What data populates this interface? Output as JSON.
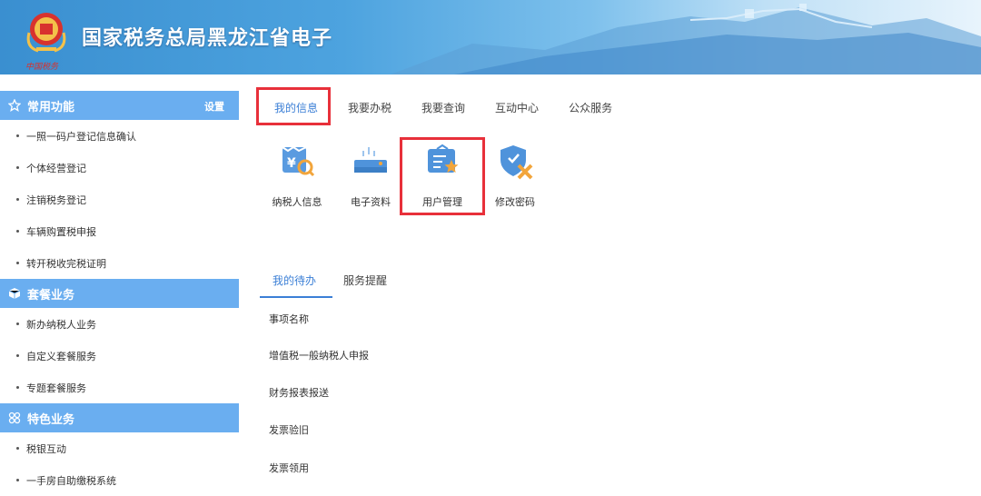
{
  "header": {
    "title": "国家税务总局黑龙江省电子",
    "emblem_caption": "中国税务"
  },
  "sidebar": {
    "sections": [
      {
        "title": "常用功能",
        "icon": "star-icon",
        "setting_label": "设置",
        "items": [
          "一照一码户登记信息确认",
          "个体经营登记",
          "注销税务登记",
          "车辆购置税申报",
          "转开税收完税证明"
        ]
      },
      {
        "title": "套餐业务",
        "icon": "cube-icon",
        "items": [
          "新办纳税人业务",
          "自定义套餐服务",
          "专题套餐服务"
        ]
      },
      {
        "title": "特色业务",
        "icon": "grid-icon",
        "items": [
          "税银互动",
          "一手房自助缴税系统"
        ]
      }
    ]
  },
  "tabs": [
    "我的信息",
    "我要办税",
    "我要查询",
    "互动中心",
    "公众服务"
  ],
  "functions": [
    {
      "label": "纳税人信息",
      "icon": "taxpayer-info-icon"
    },
    {
      "label": "电子资料",
      "icon": "e-document-icon"
    },
    {
      "label": "用户管理",
      "icon": "user-management-icon"
    },
    {
      "label": "修改密码",
      "icon": "change-password-icon"
    }
  ],
  "todo": {
    "tabs": [
      "我的待办",
      "服务提醒"
    ],
    "header": "事项名称",
    "rows": [
      "增值税一般纳税人申报",
      "财务报表报送",
      "发票验旧",
      "发票领用"
    ]
  },
  "colors": {
    "accent": "#3b7fd6",
    "sidebar_head": "#6aaef0",
    "highlight": "#e8303a"
  }
}
